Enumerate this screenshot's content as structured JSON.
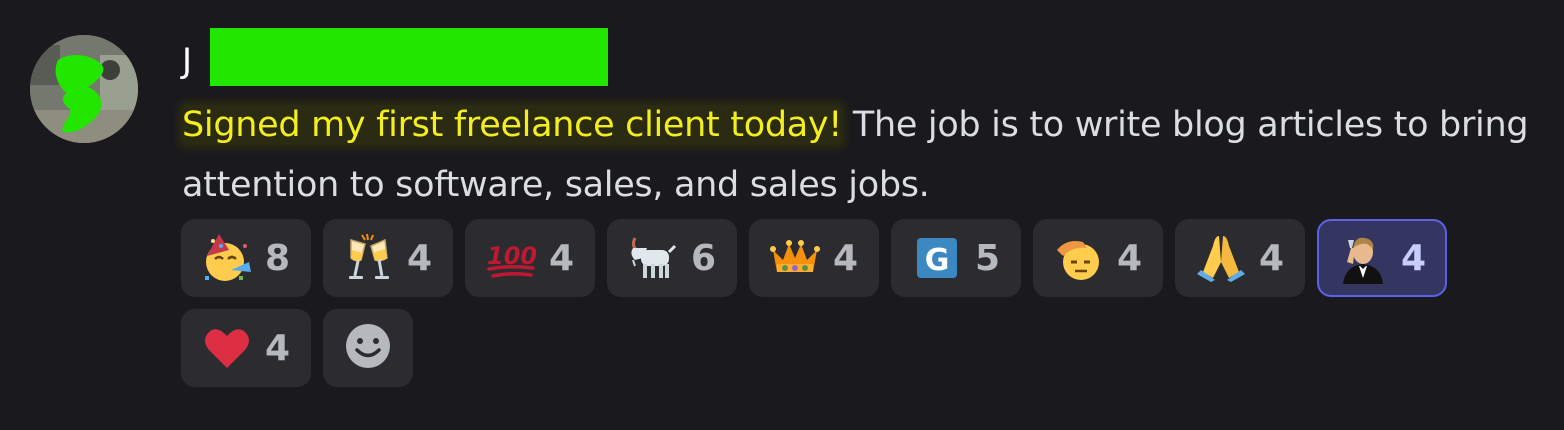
{
  "message": {
    "author_initial": "J",
    "content_highlight": "Signed my first freelance client today!",
    "content_rest": " The job is to write blog articles to bring attention to software, sales, and sales jobs."
  },
  "reactions": [
    {
      "emoji": "partying-face-icon",
      "count": "8",
      "active": false
    },
    {
      "emoji": "clinking-glasses-icon",
      "count": "4",
      "active": false
    },
    {
      "emoji": "hundred-points-icon",
      "count": "4",
      "active": false
    },
    {
      "emoji": "goat-icon",
      "count": "6",
      "active": false
    },
    {
      "emoji": "crown-icon",
      "count": "4",
      "active": false
    },
    {
      "emoji": "g-letter-icon",
      "count": "5",
      "active": false
    },
    {
      "emoji": "saluting-face-icon",
      "count": "4",
      "active": false
    },
    {
      "emoji": "folded-hands-icon",
      "count": "4",
      "active": false
    },
    {
      "emoji": "leo-toast-custom-icon",
      "count": "4",
      "active": true
    },
    {
      "emoji": "red-heart-icon",
      "count": "4",
      "active": false
    }
  ],
  "colors": {
    "background": "#1a1a1e",
    "pill": "#2b2b30",
    "active_pill": "#343661",
    "active_border": "#5b62e6",
    "highlight_text": "#f3ef1f",
    "redaction": "#22e500"
  }
}
